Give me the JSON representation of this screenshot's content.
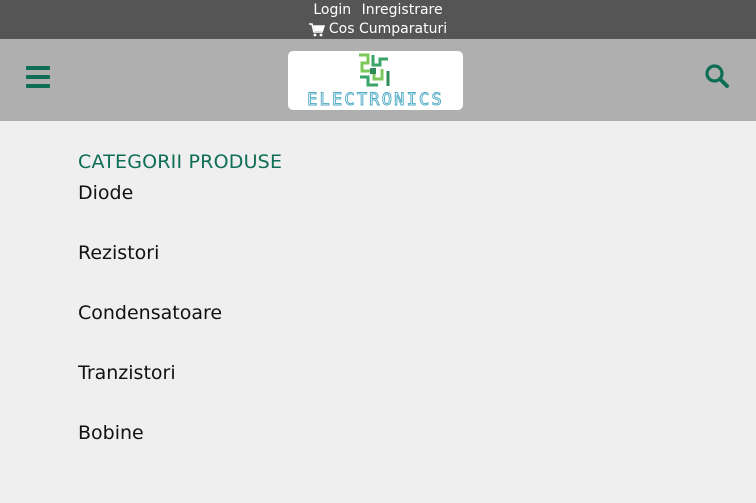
{
  "topbar": {
    "login_label": "Login",
    "register_label": "Inregistrare",
    "cart_label": "Cos Cumparaturi",
    "cart_icon": "shopping-cart-icon"
  },
  "header": {
    "menu_icon": "hamburger-menu-icon",
    "logo_text": "ELECTRONICS",
    "search_icon": "search-icon",
    "accent_color": "#0e6e55",
    "background_color": "#afafaf"
  },
  "categories": {
    "title": "CATEGORII PRODUSE",
    "items": [
      {
        "label": "Diode"
      },
      {
        "label": "Rezistori"
      },
      {
        "label": "Condensatoare"
      },
      {
        "label": "Tranzistori"
      },
      {
        "label": "Bobine"
      }
    ]
  }
}
